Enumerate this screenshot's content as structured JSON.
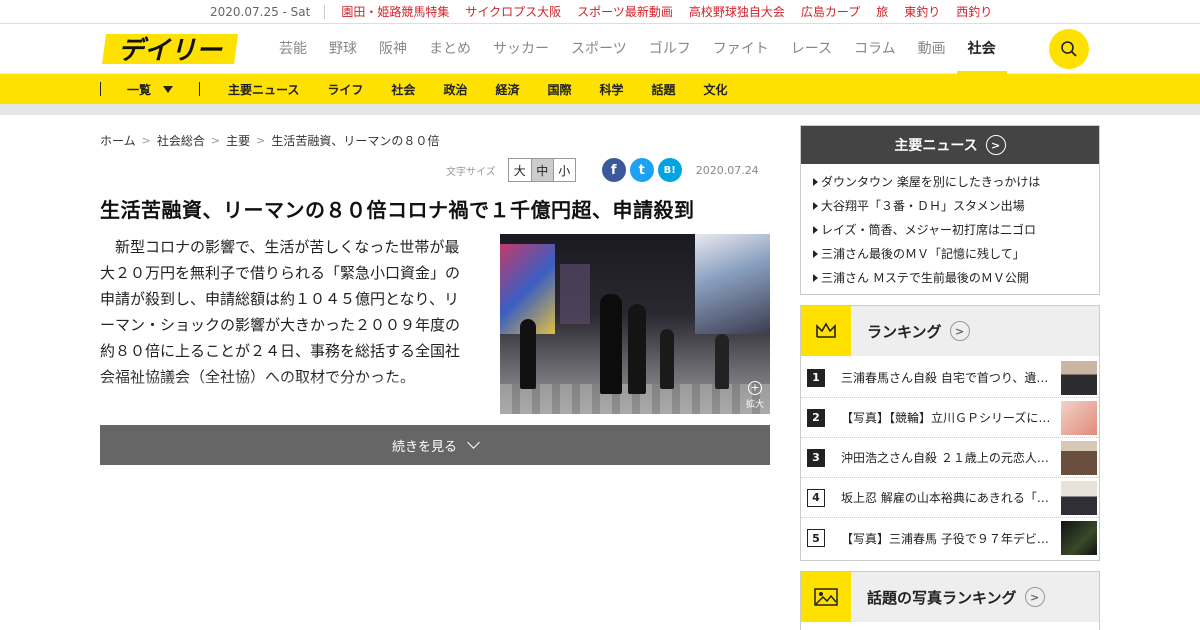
{
  "topbar": {
    "date": "2020.07.25 - Sat",
    "links": [
      "園田・姫路競馬特集",
      "サイクロプス大阪",
      "スポーツ最新動画",
      "高校野球独自大会",
      "広島カープ",
      "旅",
      "東釣り",
      "西釣り"
    ]
  },
  "header": {
    "logo_text": "デイリー",
    "nav": [
      "芸能",
      "野球",
      "阪神",
      "まとめ",
      "サッカー",
      "スポーツ",
      "ゴルフ",
      "ファイト",
      "レース",
      "コラム",
      "動画",
      "社会"
    ],
    "active_nav": "社会"
  },
  "subnav": {
    "all_label": "一覧",
    "items": [
      "主要ニュース",
      "ライフ",
      "社会",
      "政治",
      "経済",
      "国際",
      "科学",
      "話題",
      "文化"
    ]
  },
  "breadcrumb": [
    "ホーム",
    "社会総合",
    "主要",
    "生活苦融資、リーマンの８０倍"
  ],
  "tools": {
    "font_size_label": "文字サイズ",
    "sizes": [
      "大",
      "中",
      "小"
    ],
    "selected_size": "中",
    "share": [
      "f",
      "t",
      "B!"
    ],
    "date": "2020.07.24"
  },
  "article": {
    "title": "生活苦融資、リーマンの８０倍コロナ禍で１千億円超、申請殺到",
    "body": "新型コロナの影響で、生活が苦しくなった世帯が最大２０万円を無利子で借りられる「緊急小口資金」の申請が殺到し、申請総額は約１０４５億円となり、リーマン・ショックの影響が大きかった２００９年度の約８０倍に上ることが２４日、事務を総括する全国社会福祉協議会（全社協）への取材で分かった。",
    "zoom_label": "拡大",
    "more_label": "続きを見る"
  },
  "sidebar": {
    "news_title": "主要ニュース",
    "news": [
      "ダウンタウン 楽屋を別にしたきっかけは",
      "大谷翔平「３番・ＤＨ」スタメン出場",
      "レイズ・筒香、メジャー初打席は二ゴロ",
      "三浦さん最後のＭＶ「記憶に残して」",
      "三浦さん Ｍステで生前最後のＭＶ公開"
    ],
    "ranking_title": "ランキング",
    "ranking": [
      {
        "rank": "1",
        "text": "三浦春馬さん自殺 自宅で首つり、遺書…"
      },
      {
        "rank": "2",
        "text": "【写真】【競輪】立川ＧＰシリーズに…"
      },
      {
        "rank": "3",
        "text": "沖田浩之さん自殺 ２１歳上の元恋人…"
      },
      {
        "rank": "4",
        "text": "坂上忍 解雇の山本裕典にあきれる「…"
      },
      {
        "rank": "5",
        "text": "【写真】三浦春馬 子役で９７年デビ…"
      }
    ],
    "photo_ranking_title": "話題の写真ランキング"
  },
  "colors": {
    "brand_yellow": "#ffe100",
    "accent_red": "#d1232a",
    "facebook": "#3b5998",
    "twitter": "#1da1f2",
    "hatena": "#00a4de"
  }
}
